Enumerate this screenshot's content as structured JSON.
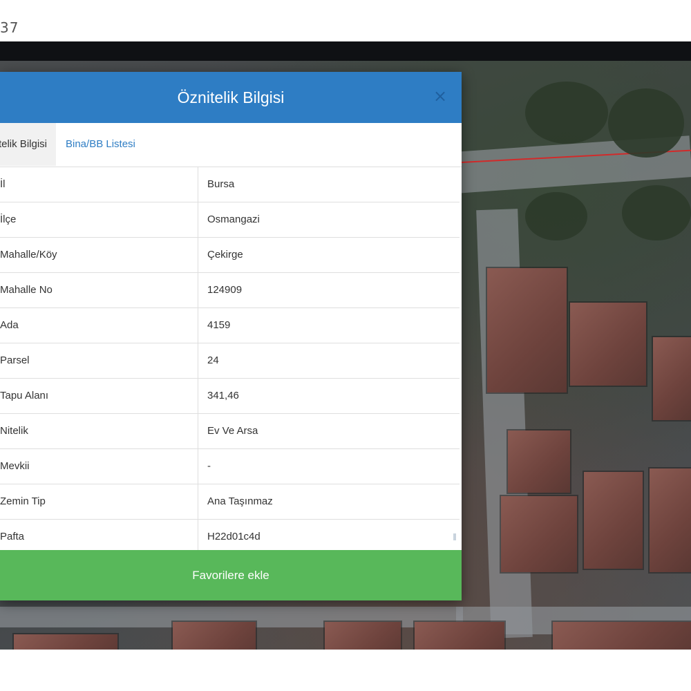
{
  "page_label": "37",
  "dialog": {
    "title": "Öznitelik Bilgisi",
    "close_icon": "×",
    "tabs": [
      {
        "label": "Öznitelik Bilgisi",
        "active": true
      },
      {
        "label": "Bina/BB Listesi",
        "active": false
      }
    ],
    "rows": [
      {
        "label": "İl",
        "value": "Bursa"
      },
      {
        "label": "İlçe",
        "value": "Osmangazi"
      },
      {
        "label": "Mahalle/Köy",
        "value": "Çekirge"
      },
      {
        "label": "Mahalle No",
        "value": "124909"
      },
      {
        "label": "Ada",
        "value": "4159"
      },
      {
        "label": "Parsel",
        "value": "24"
      },
      {
        "label": "Tapu Alanı",
        "value": "341,46"
      },
      {
        "label": "Nitelik",
        "value": "Ev Ve Arsa"
      },
      {
        "label": "Mevkii",
        "value": "-"
      },
      {
        "label": "Zemin Tip",
        "value": "Ana Taşınmaz"
      },
      {
        "label": "Pafta",
        "value": "H22d01c4d"
      }
    ],
    "favorite_button": "Favorilere ekle"
  },
  "colors": {
    "header": "#2e7dc4",
    "button": "#58b85a",
    "parcel_line": "#d22a2a"
  }
}
